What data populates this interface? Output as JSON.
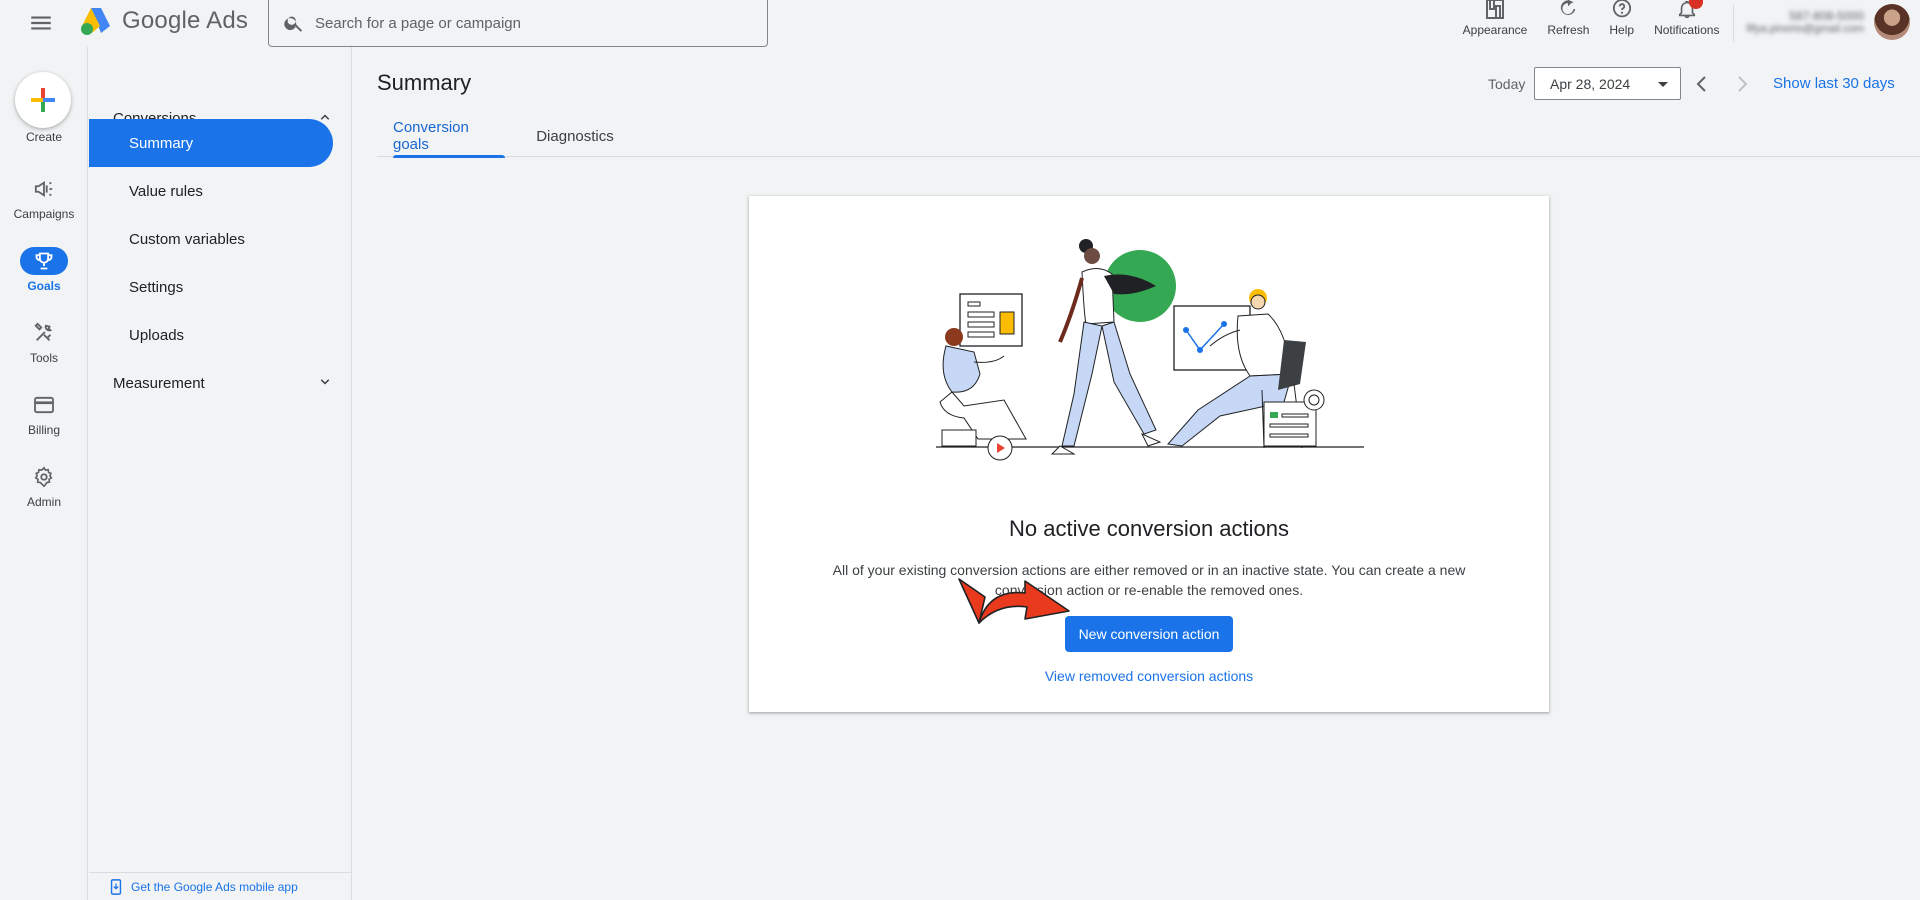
{
  "app": {
    "name": "Google Ads"
  },
  "search": {
    "placeholder": "Search for a page or campaign"
  },
  "top_actions": [
    {
      "label": "Appearance",
      "icon": "appearance-icon"
    },
    {
      "label": "Refresh",
      "icon": "refresh-icon"
    },
    {
      "label": "Help",
      "icon": "help-icon"
    },
    {
      "label": "Notifications",
      "icon": "bell-icon"
    }
  ],
  "account": {
    "id": "587-808-5000",
    "email": "fifya.pinorio@gmail.com"
  },
  "rail": {
    "create_label": "Create",
    "items": [
      {
        "label": "Campaigns",
        "icon": "megaphone-icon"
      },
      {
        "label": "Goals",
        "icon": "trophy-icon",
        "active": true
      },
      {
        "label": "Tools",
        "icon": "tools-icon"
      },
      {
        "label": "Billing",
        "icon": "credit-card-icon"
      },
      {
        "label": "Admin",
        "icon": "gear-icon"
      }
    ]
  },
  "subnav": {
    "conversions": "Conversions",
    "items": [
      "Summary",
      "Value rules",
      "Custom variables",
      "Settings",
      "Uploads"
    ],
    "active_item": "Summary",
    "measurement": "Measurement",
    "mobile_app": "Get the Google Ads mobile app"
  },
  "header": {
    "title": "Summary",
    "today_label": "Today",
    "date_value": "Apr 28, 2024",
    "show_last": "Show last 30 days"
  },
  "tabs": [
    "Conversion goals",
    "Diagnostics"
  ],
  "empty_state": {
    "title": "No active conversion actions",
    "description": "All of your existing conversion actions are either removed or in an inactive state. You can create a new conversion action or re-enable the removed ones.",
    "primary_button": "New conversion action",
    "secondary_link": "View removed conversion actions"
  },
  "colors": {
    "accent": "#1a73e8",
    "background": "#f1f3f4",
    "annotation_arrow": "#ea3a1e"
  }
}
